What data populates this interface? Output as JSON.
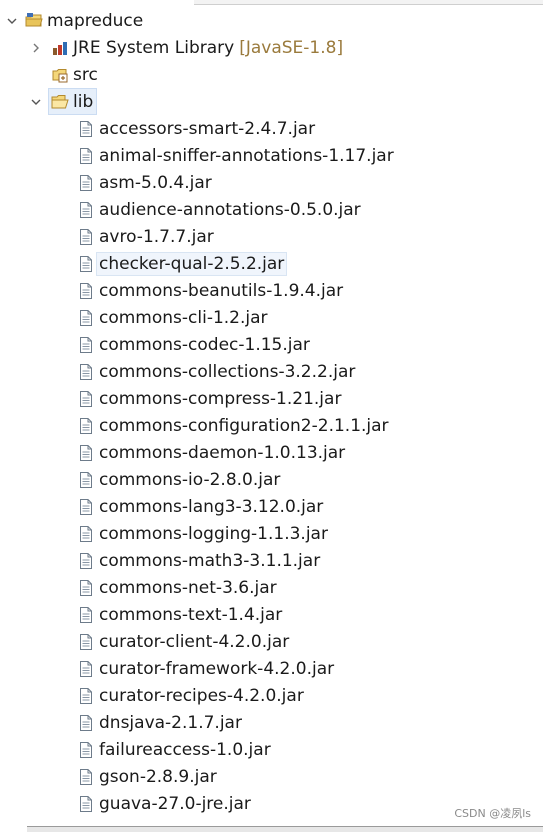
{
  "project": {
    "name": "mapreduce",
    "expanded": true
  },
  "children": [
    {
      "kind": "library",
      "label": "JRE System Library",
      "decoration": "[JavaSE-1.8]",
      "expanded": false
    },
    {
      "kind": "source-folder",
      "label": "src"
    },
    {
      "kind": "folder",
      "label": "lib",
      "expanded": true,
      "selected": true
    }
  ],
  "lib_files": [
    "accessors-smart-2.4.7.jar",
    "animal-sniffer-annotations-1.17.jar",
    "asm-5.0.4.jar",
    "audience-annotations-0.5.0.jar",
    "avro-1.7.7.jar",
    "checker-qual-2.5.2.jar",
    "commons-beanutils-1.9.4.jar",
    "commons-cli-1.2.jar",
    "commons-codec-1.15.jar",
    "commons-collections-3.2.2.jar",
    "commons-compress-1.21.jar",
    "commons-configuration2-2.1.1.jar",
    "commons-daemon-1.0.13.jar",
    "commons-io-2.8.0.jar",
    "commons-lang3-3.12.0.jar",
    "commons-logging-1.1.3.jar",
    "commons-math3-3.1.1.jar",
    "commons-net-3.6.jar",
    "commons-text-1.4.jar",
    "curator-client-4.2.0.jar",
    "curator-framework-4.2.0.jar",
    "curator-recipes-4.2.0.jar",
    "dnsjava-2.1.7.jar",
    "failureaccess-1.0.jar",
    "gson-2.8.9.jar",
    "guava-27.0-jre.jar"
  ],
  "highlighted_file": "checker-qual-2.5.2.jar",
  "watermark": "CSDN @凌夙ls",
  "colors": {
    "selection_bg": "#e6effa",
    "decoration_text": "#9a7a3c",
    "folder_yellow": "#e8c45a"
  },
  "icons": {
    "expanded": "chevron-down-icon",
    "collapsed": "chevron-right-icon",
    "project": "java-project-icon",
    "library": "library-icon",
    "source_folder": "source-folder-icon",
    "folder_open": "open-folder-icon",
    "jar": "jar-file-icon"
  }
}
